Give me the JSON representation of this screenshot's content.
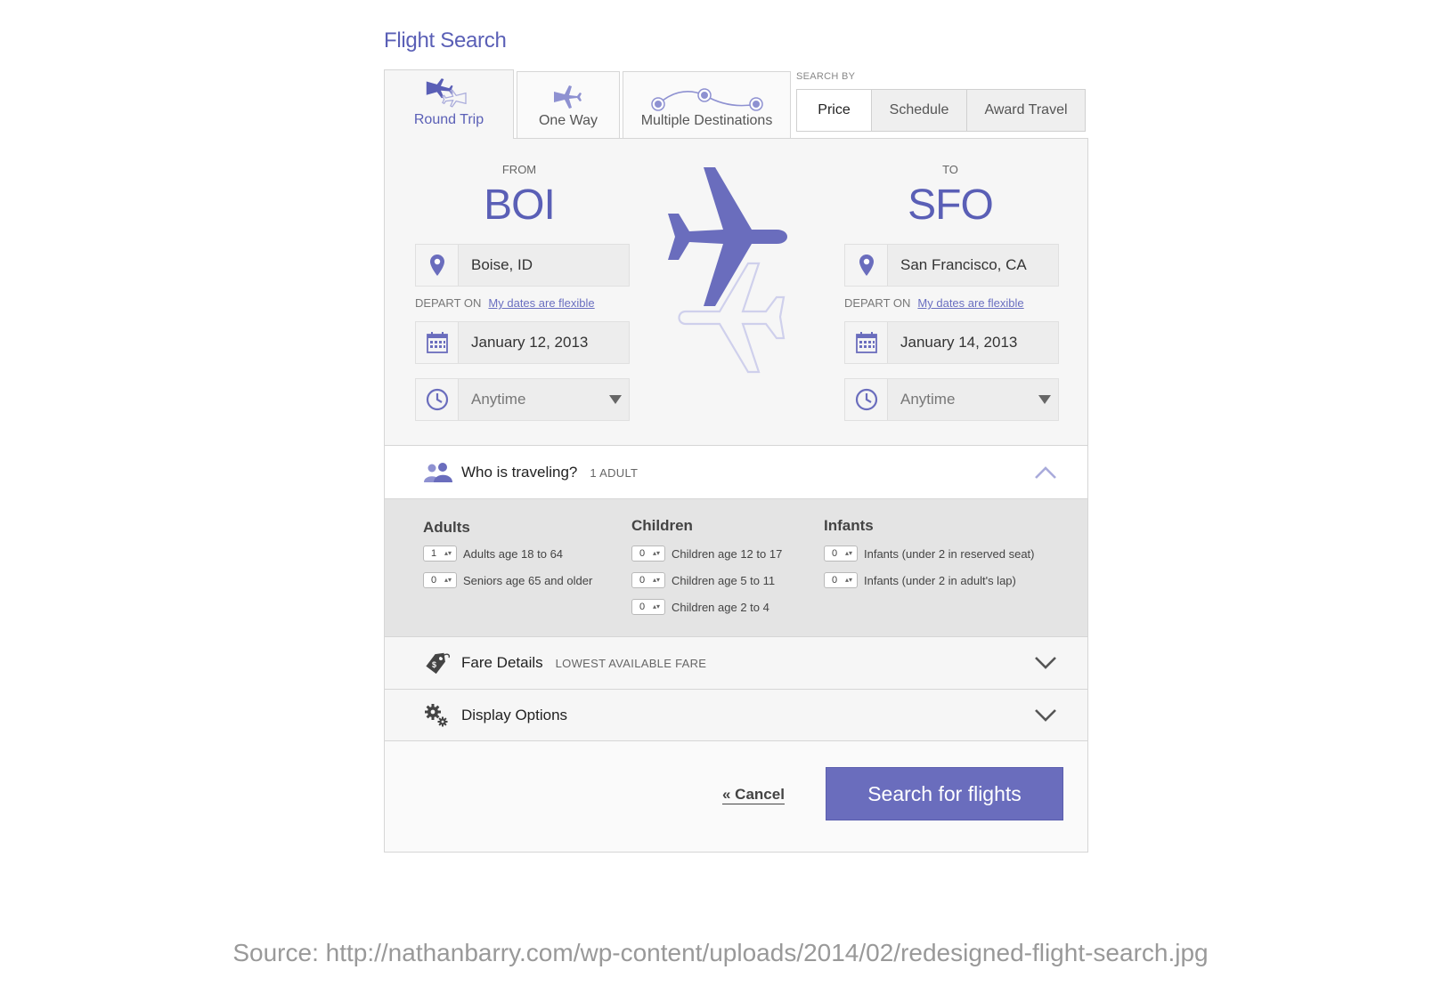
{
  "page_title": "Flight Search",
  "tabs": [
    {
      "label": "Round Trip",
      "active": true,
      "icon": "round-trip-icon"
    },
    {
      "label": "One Way",
      "active": false,
      "icon": "one-way-icon"
    },
    {
      "label": "Multiple Destinations",
      "active": false,
      "icon": "multi-destination-icon"
    }
  ],
  "search_by": {
    "label": "SEARCH BY",
    "options": [
      "Price",
      "Schedule",
      "Award Travel"
    ],
    "selected": "Price"
  },
  "from": {
    "label": "FROM",
    "code": "BOI",
    "city": "Boise, ID",
    "depart_label": "DEPART ON",
    "flexible_link": "My dates are flexible",
    "date": "January 12, 2013",
    "time": "Anytime"
  },
  "to": {
    "label": "TO",
    "code": "SFO",
    "city": "San Francisco, CA",
    "depart_label": "DEPART ON",
    "flexible_link": "My dates are flexible",
    "date": "January 14, 2013",
    "time": "Anytime"
  },
  "travelers": {
    "title": "Who is traveling?",
    "summary": "1 ADULT",
    "columns": [
      {
        "heading": "Adults",
        "rows": [
          {
            "value": "1",
            "label": "Adults age 18 to 64"
          },
          {
            "value": "0",
            "label": "Seniors age 65 and older"
          }
        ]
      },
      {
        "heading": "Children",
        "rows": [
          {
            "value": "0",
            "label": "Children age 12 to 17"
          },
          {
            "value": "0",
            "label": "Children age 5 to 11"
          },
          {
            "value": "0",
            "label": "Children age 2 to 4"
          }
        ]
      },
      {
        "heading": "Infants",
        "rows": [
          {
            "value": "0",
            "label": "Infants (under 2 in reserved seat)"
          },
          {
            "value": "0",
            "label": "Infants (under 2 in adult's lap)"
          }
        ]
      }
    ]
  },
  "fare_details": {
    "title": "Fare Details",
    "summary": "LOWEST AVAILABLE FARE"
  },
  "display_options": {
    "title": "Display Options"
  },
  "actions": {
    "cancel": "« Cancel",
    "search": "Search for flights"
  },
  "source_caption": "Source: http://nathanbarry.com/wp-content/uploads/2014/02/redesigned-flight-search.jpg",
  "colors": {
    "accent": "#5a5fb6",
    "button": "#6a6dbd",
    "panel_bg": "#f6f6f6",
    "detail_bg": "#e4e4e4"
  }
}
